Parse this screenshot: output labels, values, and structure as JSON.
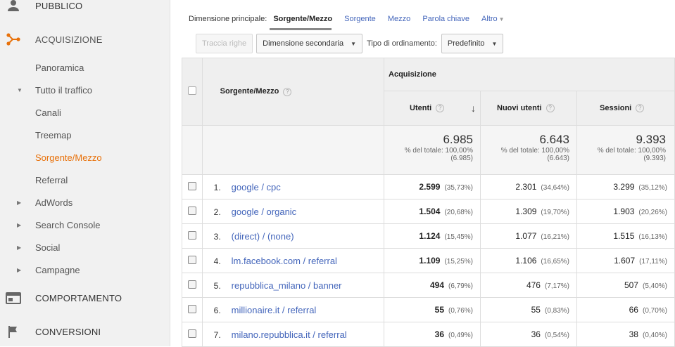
{
  "sidebar": {
    "sections": [
      {
        "label": "PUBBLICO",
        "icon": "person-icon"
      },
      {
        "label": "ACQUISIZIONE",
        "icon": "acquisition-icon"
      },
      {
        "label": "COMPORTAMENTO",
        "icon": "behavior-icon"
      },
      {
        "label": "CONVERSIONI",
        "icon": "flag-icon"
      }
    ],
    "items": [
      {
        "label": "Panoramica"
      },
      {
        "label": "Tutto il traffico"
      },
      {
        "label": "Canali"
      },
      {
        "label": "Treemap"
      },
      {
        "label": "Sorgente/Mezzo"
      },
      {
        "label": "Referral"
      },
      {
        "label": "AdWords"
      },
      {
        "label": "Search Console"
      },
      {
        "label": "Social"
      },
      {
        "label": "Campagne"
      }
    ],
    "accent_color": "#e8710a"
  },
  "dimension": {
    "label": "Dimensione principale:",
    "current": "Sorgente/Mezzo",
    "options": [
      "Sorgente",
      "Mezzo",
      "Parola chiave"
    ],
    "more": "Altro"
  },
  "toolbar": {
    "plot_rows": "Traccia righe",
    "secondary_dimension": "Dimensione secondaria",
    "sort_label": "Tipo di ordinamento:",
    "sort_value": "Predefinito"
  },
  "table": {
    "col_dimension": "Sorgente/Mezzo",
    "group_header": "Acquisizione",
    "columns": [
      "Utenti",
      "Nuovi utenti",
      "Sessioni"
    ],
    "totals": [
      {
        "value": "6.985",
        "pct_label": "% del totale: 100,00%",
        "of_total": "(6.985)"
      },
      {
        "value": "6.643",
        "pct_label": "% del totale: 100,00%",
        "of_total": "(6.643)"
      },
      {
        "value": "9.393",
        "pct_label": "% del totale: 100,00%",
        "of_total": "(9.393)"
      }
    ],
    "rows": [
      {
        "idx": "1.",
        "source": "google / cpc",
        "users": "2.599",
        "users_pct": "(35,73%)",
        "new_users": "2.301",
        "new_users_pct": "(34,64%)",
        "sessions": "3.299",
        "sessions_pct": "(35,12%)"
      },
      {
        "idx": "2.",
        "source": "google / organic",
        "users": "1.504",
        "users_pct": "(20,68%)",
        "new_users": "1.309",
        "new_users_pct": "(19,70%)",
        "sessions": "1.903",
        "sessions_pct": "(20,26%)"
      },
      {
        "idx": "3.",
        "source": "(direct) / (none)",
        "users": "1.124",
        "users_pct": "(15,45%)",
        "new_users": "1.077",
        "new_users_pct": "(16,21%)",
        "sessions": "1.515",
        "sessions_pct": "(16,13%)"
      },
      {
        "idx": "4.",
        "source": "lm.facebook.com / referral",
        "users": "1.109",
        "users_pct": "(15,25%)",
        "new_users": "1.106",
        "new_users_pct": "(16,65%)",
        "sessions": "1.607",
        "sessions_pct": "(17,11%)"
      },
      {
        "idx": "5.",
        "source": "repubblica_milano / banner",
        "users": "494",
        "users_pct": "(6,79%)",
        "new_users": "476",
        "new_users_pct": "(7,17%)",
        "sessions": "507",
        "sessions_pct": "(5,40%)"
      },
      {
        "idx": "6.",
        "source": "millionaire.it / referral",
        "users": "55",
        "users_pct": "(0,76%)",
        "new_users": "55",
        "new_users_pct": "(0,83%)",
        "sessions": "66",
        "sessions_pct": "(0,70%)"
      },
      {
        "idx": "7.",
        "source": "milano.repubblica.it / referral",
        "users": "36",
        "users_pct": "(0,49%)",
        "new_users": "36",
        "new_users_pct": "(0,54%)",
        "sessions": "38",
        "sessions_pct": "(0,40%)"
      }
    ]
  }
}
